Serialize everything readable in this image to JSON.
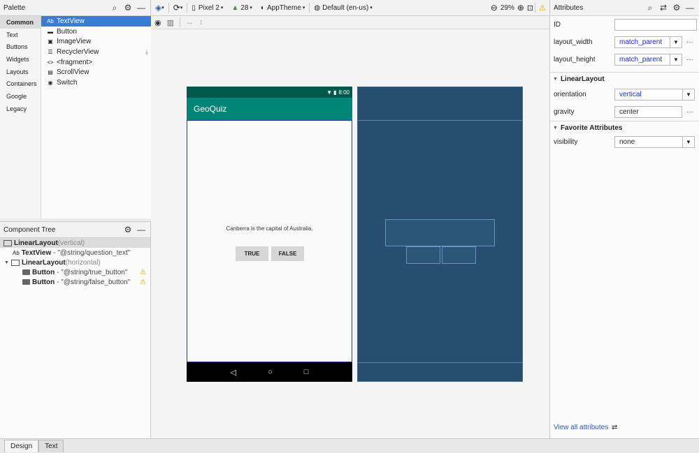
{
  "palette": {
    "title": "Palette",
    "categories": [
      "Common",
      "Text",
      "Buttons",
      "Widgets",
      "Layouts",
      "Containers",
      "Google",
      "Legacy"
    ],
    "items": [
      {
        "icon": "Ab",
        "label": "TextView"
      },
      {
        "icon": "▬",
        "label": "Button"
      },
      {
        "icon": "▣",
        "label": "ImageView"
      },
      {
        "icon": "☰",
        "label": "RecyclerView"
      },
      {
        "icon": "<>",
        "label": "<fragment>"
      },
      {
        "icon": "▤",
        "label": "ScrollView"
      },
      {
        "icon": "◉",
        "label": "Switch"
      }
    ]
  },
  "component_tree": {
    "title": "Component Tree",
    "nodes": [
      {
        "name": "LinearLayout",
        "annot": "(vertical)",
        "value": ""
      },
      {
        "prefix": "Ab",
        "name": "TextView",
        "annot": "",
        "value": "- \"@string/question_text\""
      },
      {
        "name": "LinearLayout",
        "annot": "(horizontal)",
        "value": ""
      },
      {
        "name": "Button",
        "annot": "",
        "value": "- \"@string/true_button\""
      },
      {
        "name": "Button",
        "annot": "",
        "value": "- \"@string/false_button\""
      }
    ]
  },
  "toolbar": {
    "device": "Pixel 2",
    "api": "28",
    "theme": "AppTheme",
    "locale": "Default (en-us)",
    "zoom": "29%"
  },
  "preview": {
    "status_time": "8:00",
    "app_title": "GeoQuiz",
    "question": "Canberra is the capital of Australia.",
    "true_button": "TRUE",
    "false_button": "FALSE"
  },
  "attributes": {
    "title": "Attributes",
    "id_label": "ID",
    "id_value": "",
    "layout_width_label": "layout_width",
    "layout_width_value": "match_parent",
    "layout_height_label": "layout_height",
    "layout_height_value": "match_parent",
    "section_linear": "LinearLayout",
    "orientation_label": "orientation",
    "orientation_value": "vertical",
    "gravity_label": "gravity",
    "gravity_value": "center",
    "section_fav": "Favorite Attributes",
    "visibility_label": "visibility",
    "visibility_value": "none",
    "view_all": "View all attributes"
  },
  "bottom_tabs": [
    "Design",
    "Text"
  ],
  "colors": {
    "accent": "#3a7bd5",
    "app_bar": "#008577",
    "status_bar": "#00574b",
    "blueprint": "#264e6f",
    "warning": "#e8a200"
  }
}
